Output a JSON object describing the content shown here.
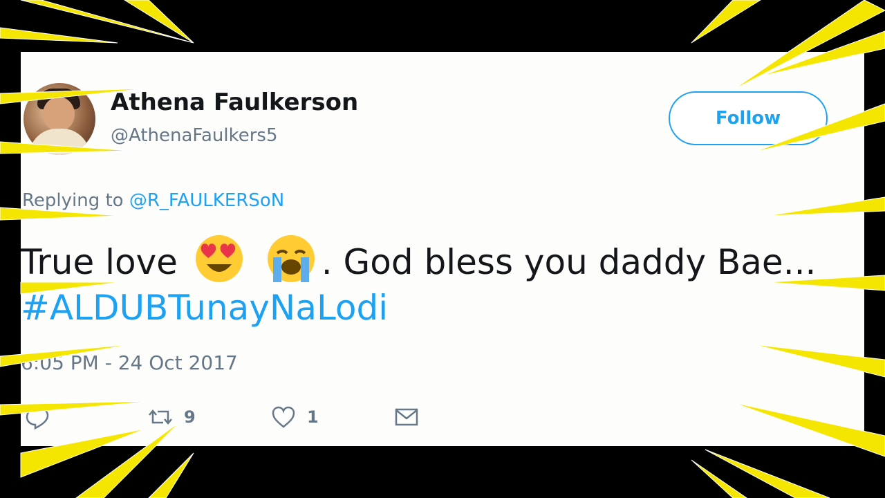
{
  "tweet": {
    "author_name": "Athena Faulkerson",
    "author_handle": "@AthenaFaulkers5",
    "follow_label": "Follow",
    "replying_prefix": "Replying to ",
    "replying_mention": "@R_FAULKERSoN",
    "text_part1": "True love",
    "text_part2": ". God bless you daddy Bae...",
    "emoji_1": "heart-eyes-emoji",
    "emoji_2": "loudly-crying-emoji",
    "hashtag": "#ALDUBTunayNaLodi",
    "timestamp": "6:05 PM - 24 Oct 2017",
    "actions": {
      "reply_icon": "reply-icon",
      "retweet_icon": "retweet-icon",
      "retweet_count": "9",
      "like_icon": "heart-icon",
      "like_count": "1",
      "dm_icon": "envelope-icon"
    }
  },
  "colors": {
    "accent": "#1da1f2",
    "text": "#14171a",
    "muted": "#657786",
    "burst": "#f5e600"
  }
}
